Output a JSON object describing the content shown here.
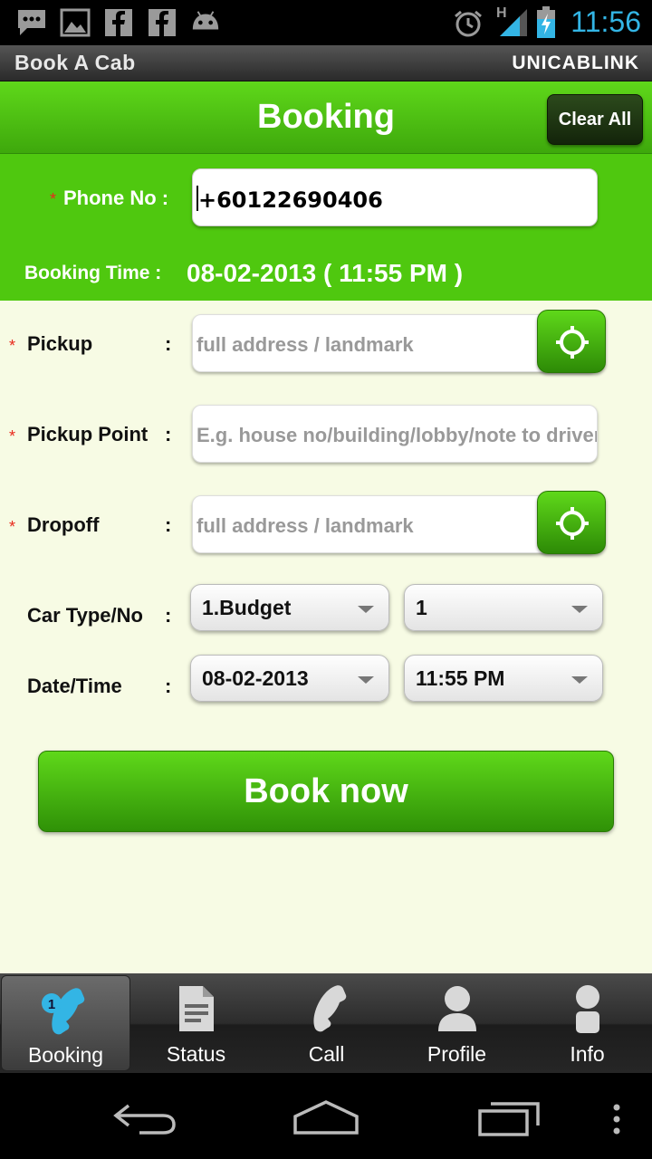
{
  "status_bar": {
    "time": "11:56",
    "left_icons": [
      "chat-icon",
      "image-icon",
      "facebook-icon",
      "facebook-icon",
      "android-icon"
    ],
    "right_icons": [
      "alarm-icon",
      "signal-icon",
      "battery-charging-icon"
    ],
    "network_label": "H"
  },
  "app_bar": {
    "title": "Book A Cab",
    "brand": "UNICABLINK"
  },
  "header": {
    "title": "Booking",
    "clear_all": "Clear All"
  },
  "top_form": {
    "phone_label": "Phone No :",
    "phone_value": "+60122690406",
    "booking_time_label": "Booking Time :",
    "booking_time_value": "08-02-2013 ( 11:55 PM )"
  },
  "form": {
    "colon": ":",
    "pickup_label": "Pickup",
    "pickup_placeholder": "full address / landmark",
    "pickup_point_label": "Pickup Point",
    "pickup_point_placeholder": "E.g. house no/building/lobby/note to driver",
    "dropoff_label": "Dropoff",
    "dropoff_placeholder": "full address / landmark",
    "car_type_label": "Car Type/No",
    "car_type_value": "1.Budget",
    "car_no_value": "1",
    "datetime_label": "Date/Time",
    "date_value": "08-02-2013",
    "time_value": "11:55 PM",
    "required_mark": "*"
  },
  "book_button": "Book now",
  "tabs": [
    {
      "label": "Booking",
      "icon": "booking-phone-icon",
      "active": true
    },
    {
      "label": "Status",
      "icon": "document-icon",
      "active": false
    },
    {
      "label": "Call",
      "icon": "phone-icon",
      "active": false
    },
    {
      "label": "Profile",
      "icon": "person-icon",
      "active": false
    },
    {
      "label": "Info",
      "icon": "info-person-icon",
      "active": false
    }
  ],
  "colors": {
    "green": "#4fc80f",
    "cream": "#f7fbe4",
    "required": "#e8291c",
    "clock": "#33b5e5"
  }
}
